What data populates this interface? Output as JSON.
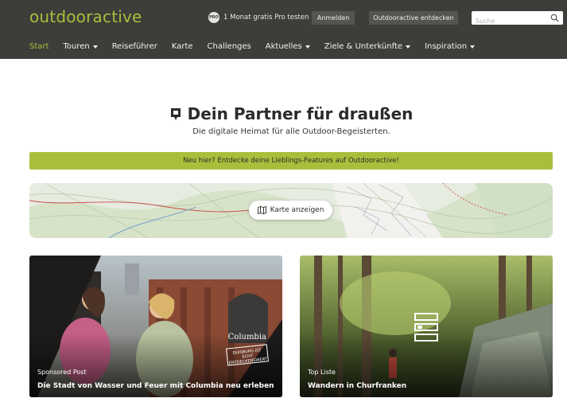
{
  "header": {
    "logo": "outdooractive",
    "pro_badge": "PRO",
    "pro_text": "1 Monat gratis Pro testen",
    "login": "Anmelden",
    "discover": "Outdooractive entdecken",
    "search_placeholder": "Suche"
  },
  "nav": [
    {
      "label": "Start",
      "active": true,
      "dropdown": false
    },
    {
      "label": "Touren",
      "active": false,
      "dropdown": true
    },
    {
      "label": "Reiseführer",
      "active": false,
      "dropdown": false
    },
    {
      "label": "Karte",
      "active": false,
      "dropdown": false
    },
    {
      "label": "Challenges",
      "active": false,
      "dropdown": false
    },
    {
      "label": "Aktuelles",
      "active": false,
      "dropdown": true
    },
    {
      "label": "Ziele & Unterkünfte",
      "active": false,
      "dropdown": true
    },
    {
      "label": "Inspiration",
      "active": false,
      "dropdown": true
    }
  ],
  "hero": {
    "title": "Dein Partner für draußen",
    "subtitle": "Die digitale Heimat für alle Outdoor-Begeisterten.",
    "banner": "Neu hier? Entdecke deine Lieblings-Features auf Outdooractive!",
    "map_button": "Karte anzeigen"
  },
  "cards": [
    {
      "tag": "Sponsored Post",
      "title": "Die Stadt von Wasser und Feuer mit Columbia neu erleben",
      "brand": "Columbia",
      "stamp": "DUISBURG IST ECHT ENTDECKENSWERT"
    },
    {
      "tag": "Top Liste",
      "title": "Wandern in Churfranken"
    }
  ],
  "colors": {
    "brand_green": "#a9bf3c",
    "header_bg": "#3d3d3a"
  }
}
